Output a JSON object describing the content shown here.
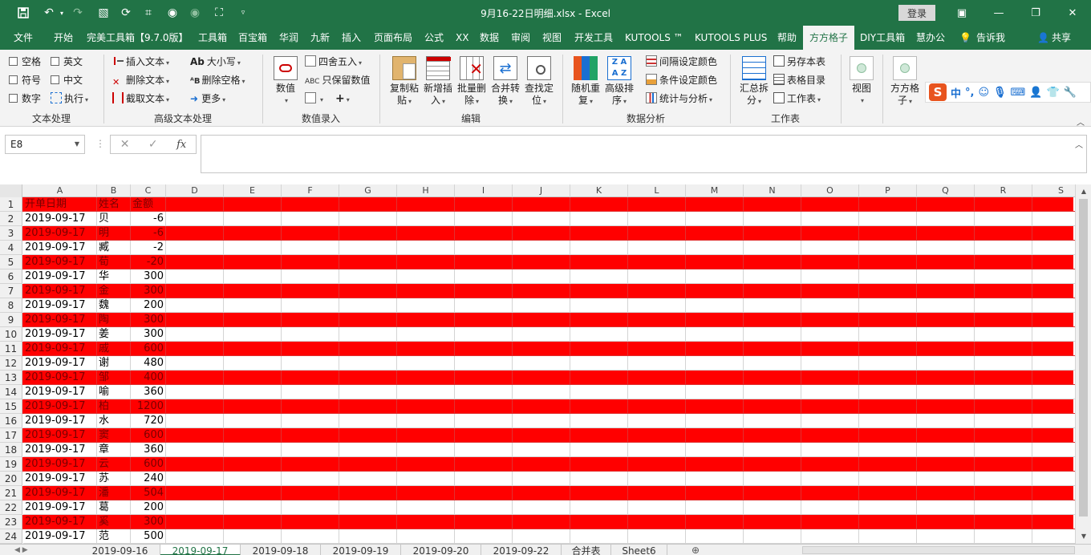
{
  "window": {
    "title": "9月16-22日明细.xlsx  -  Excel",
    "login_label": "登录"
  },
  "ribbon_tabs": [
    "文件",
    "开始",
    "完美工具箱【9.7.0版】",
    "工具箱",
    "百宝箱",
    "华润",
    "九新",
    "插入",
    "页面布局",
    "公式",
    "XX",
    "数据",
    "审阅",
    "视图",
    "开发工具",
    "KUTOOLS ™",
    "KUTOOLS PLUS",
    "帮助",
    "方方格子",
    "DIY工具箱",
    "慧办公"
  ],
  "active_tab_index": 18,
  "tell_me": "告诉我",
  "share": "共享",
  "ribbon": {
    "text_processing": {
      "label": "文本处理",
      "checks": [
        "空格",
        "英文",
        "符号",
        "中文",
        "数字"
      ],
      "execute": "执行"
    },
    "advanced_text": {
      "label": "高级文本处理",
      "insert_text": "插入文本",
      "delete_text": "删除文本",
      "cut_text": "截取文本",
      "case": "大小写",
      "delete_space": "删除空格",
      "more": "更多"
    },
    "number_entry": {
      "label": "数值录入",
      "value": "数值",
      "round": "四舍五入",
      "keep_value": "只保留数值"
    },
    "edit": {
      "label": "编辑",
      "buttons": [
        {
          "l1": "复制粘",
          "l2": "贴"
        },
        {
          "l1": "新增插",
          "l2": "入"
        },
        {
          "l1": "批量删",
          "l2": "除"
        },
        {
          "l1": "合并转",
          "l2": "换"
        },
        {
          "l1": "查找定",
          "l2": "位"
        }
      ]
    },
    "data_analysis": {
      "label": "数据分析",
      "random": {
        "l1": "随机重",
        "l2": "复"
      },
      "sort": {
        "l1": "高级排",
        "l2": "序"
      },
      "interval_color": "间隔设定颜色",
      "cond_color": "条件设定颜色",
      "stats": "统计与分析"
    },
    "worksheet": {
      "label": "工作表",
      "summary": {
        "l1": "汇总拆",
        "l2": "分"
      },
      "save_as": "另存本表",
      "sheet_dir": "表格目录",
      "worksheet": "工作表"
    },
    "view": {
      "label": "视图"
    },
    "ffgz": {
      "l1": "方方格",
      "l2": "子"
    }
  },
  "ime": {
    "zh": "中"
  },
  "formula_bar": {
    "name_box": "E8",
    "fx": "fx",
    "formula": ""
  },
  "columns": [
    "A",
    "B",
    "C",
    "D",
    "E",
    "F",
    "G",
    "H",
    "I",
    "J",
    "K",
    "L",
    "M",
    "N",
    "O",
    "P",
    "Q",
    "R",
    "S"
  ],
  "rows": [
    {
      "n": "1",
      "a": "开单日期",
      "b": "姓名",
      "c": "金额"
    },
    {
      "n": "2",
      "a": "2019-09-17",
      "b": "贝",
      "c": "-6"
    },
    {
      "n": "3",
      "a": "2019-09-17",
      "b": "明",
      "c": "-6"
    },
    {
      "n": "4",
      "a": "2019-09-17",
      "b": "臧",
      "c": "-2"
    },
    {
      "n": "5",
      "a": "2019-09-17",
      "b": "荀",
      "c": "-20"
    },
    {
      "n": "6",
      "a": "2019-09-17",
      "b": "华",
      "c": "300"
    },
    {
      "n": "7",
      "a": "2019-09-17",
      "b": "金",
      "c": "300"
    },
    {
      "n": "8",
      "a": "2019-09-17",
      "b": "魏",
      "c": "200"
    },
    {
      "n": "9",
      "a": "2019-09-17",
      "b": "陶",
      "c": "300"
    },
    {
      "n": "10",
      "a": "2019-09-17",
      "b": "姜",
      "c": "300"
    },
    {
      "n": "11",
      "a": "2019-09-17",
      "b": "戚",
      "c": "600"
    },
    {
      "n": "12",
      "a": "2019-09-17",
      "b": "谢",
      "c": "480"
    },
    {
      "n": "13",
      "a": "2019-09-17",
      "b": "邹",
      "c": "400"
    },
    {
      "n": "14",
      "a": "2019-09-17",
      "b": "喻",
      "c": "360"
    },
    {
      "n": "15",
      "a": "2019-09-17",
      "b": "柏",
      "c": "1200"
    },
    {
      "n": "16",
      "a": "2019-09-17",
      "b": "水",
      "c": "720"
    },
    {
      "n": "17",
      "a": "2019-09-17",
      "b": "窦",
      "c": "600"
    },
    {
      "n": "18",
      "a": "2019-09-17",
      "b": "章",
      "c": "360"
    },
    {
      "n": "19",
      "a": "2019-09-17",
      "b": "云",
      "c": "600"
    },
    {
      "n": "20",
      "a": "2019-09-17",
      "b": "苏",
      "c": "240"
    },
    {
      "n": "21",
      "a": "2019-09-17",
      "b": "潘",
      "c": "504"
    },
    {
      "n": "22",
      "a": "2019-09-17",
      "b": "葛",
      "c": "200"
    },
    {
      "n": "23",
      "a": "2019-09-17",
      "b": "奚",
      "c": "300"
    },
    {
      "n": "24",
      "a": "2019-09-17",
      "b": "范",
      "c": "500"
    }
  ],
  "sheet_tabs": [
    "2019-09-16",
    "2019-09-17",
    "2019-09-18",
    "2019-09-19",
    "2019-09-20",
    "2019-09-22",
    "合并表",
    "Sheet6"
  ],
  "active_sheet_index": 1,
  "colors": {
    "accent": "#217346",
    "band": "#ff0000"
  }
}
